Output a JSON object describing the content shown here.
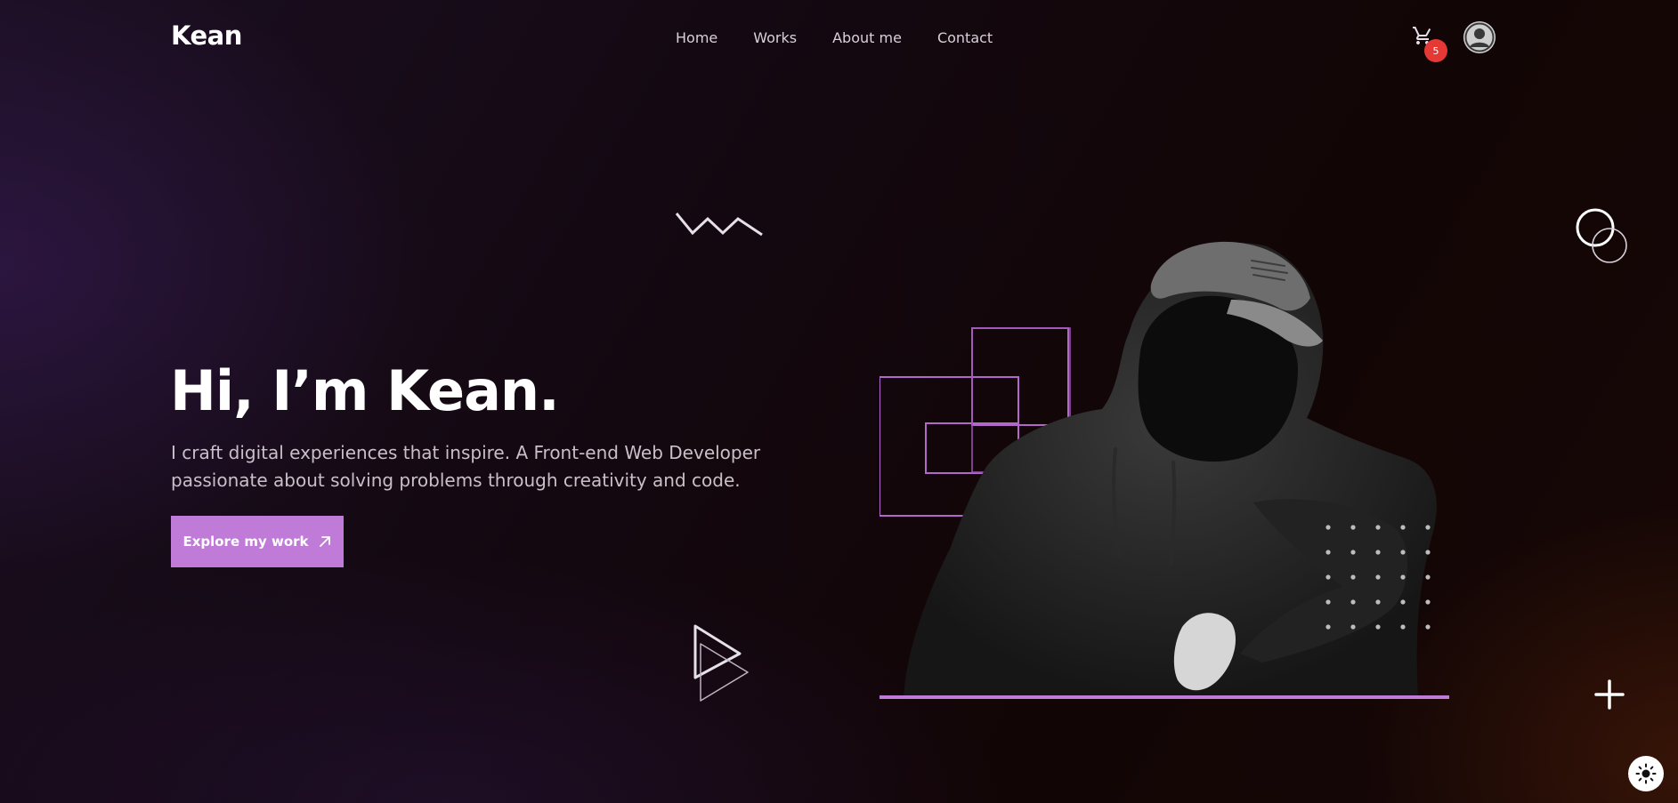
{
  "header": {
    "logo": "Kean",
    "nav": [
      "Home",
      "Works",
      "About me",
      "Contact"
    ],
    "cart_count": "5"
  },
  "hero": {
    "title": "Hi, I’m Kean.",
    "description": "I craft digital experiences that inspire. A Front-end Web Developer passionate about solving problems through creativity and code.",
    "cta_label": "Explore my work"
  },
  "colors": {
    "accent": "#c07ad8",
    "badge": "#e53935",
    "text_muted": "#c9bfc9"
  },
  "icons": [
    "cart-icon",
    "user-icon",
    "arrow-up-right-icon",
    "sun-icon"
  ]
}
